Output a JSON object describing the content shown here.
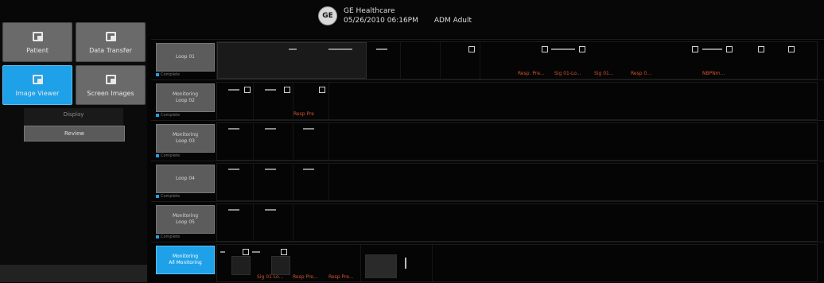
{
  "header": {
    "brand": "GE Healthcare",
    "line2": "05/26/2010 06:16PM",
    "line2b": "ADM  Adult"
  },
  "toolbar": {
    "buttons": [
      {
        "label": "Patient",
        "active": false,
        "icon": "patient-icon"
      },
      {
        "label": "Data Transfer",
        "active": false,
        "icon": "data-transfer-icon"
      },
      {
        "label": "Image Viewer",
        "active": true,
        "icon": "image-viewer-icon"
      },
      {
        "label": "Screen Images",
        "active": false,
        "icon": "screen-images-icon"
      }
    ],
    "filter_label": "Display",
    "filter_button": "Review"
  },
  "rows": [
    {
      "label_line1": "",
      "label_line2": "Loop 01",
      "sub": "Complete",
      "active": false,
      "orange": [
        "Resp. Pre...",
        "Sig 01-Lo...",
        "Sig 01...",
        "Resp 0...",
        "NBPNm..."
      ]
    },
    {
      "label_line1": "Monitoring",
      "label_line2": "Loop 02",
      "sub": "Complete",
      "active": false,
      "orange": [
        "Resp Pre"
      ]
    },
    {
      "label_line1": "Monitoring",
      "label_line2": "Loop 03",
      "sub": "Complete",
      "active": false,
      "orange": []
    },
    {
      "label_line1": "",
      "label_line2": "Loop 04",
      "sub": "Complete",
      "active": false,
      "orange": []
    },
    {
      "label_line1": "Monitoring",
      "label_line2": "Loop 05",
      "sub": "Complete",
      "active": false,
      "orange": []
    },
    {
      "label_line1": "Monitoring",
      "label_line2": "All Monitoring",
      "sub": "",
      "active": true,
      "orange": [
        "Sig 01 Lo...",
        "Resp Pre...",
        "Resp Pre..."
      ]
    }
  ],
  "colors": {
    "accent": "#1ea1e8",
    "alarm": "#d6542a"
  }
}
